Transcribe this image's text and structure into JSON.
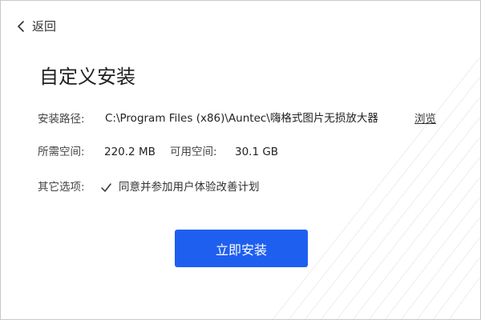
{
  "nav": {
    "back_label": "返回",
    "back_icon": "chevron-left-icon"
  },
  "page": {
    "title": "自定义安装"
  },
  "form": {
    "path_label": "安装路径:",
    "path_value": "C:\\Program Files (x86)\\Auntec\\嗨格式图片无损放大器",
    "browse_label": "浏览",
    "required_label": "所需空间:",
    "required_value": "220.2 MB",
    "available_label": "可用空间:",
    "available_value": "30.1 GB",
    "options_label": "其它选项:",
    "checkbox_label": "同意并参加用户体验改善计划",
    "checkbox_checked": true
  },
  "actions": {
    "install_label": "立即安装"
  },
  "colors": {
    "accent": "#1f5ff0",
    "text": "#333333",
    "background": "#ffffff"
  }
}
